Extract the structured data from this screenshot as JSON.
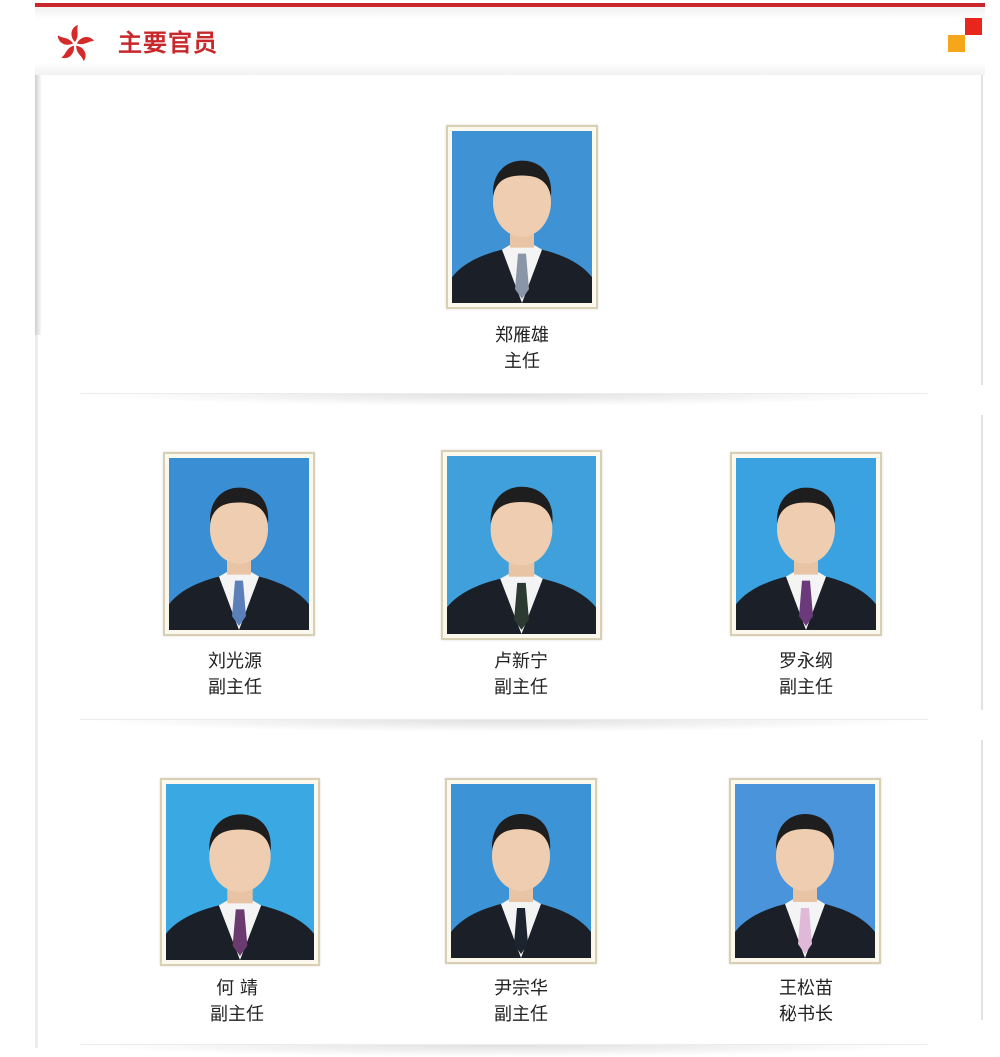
{
  "header": {
    "title": "主要官员",
    "logo_icon": "bauhinia-flower-icon",
    "corner_icon": "corner-squares-icon",
    "accent_color": "#c8282b"
  },
  "officials": [
    {
      "name": "郑雁雄",
      "title": "主任",
      "tie_color": "#8a96a8",
      "bg": "#3f92d4"
    },
    {
      "name": "刘光源",
      "title": "副主任",
      "tie_color": "#5b7fb8",
      "bg": "#3a8fd4"
    },
    {
      "name": "卢新宁",
      "title": "副主任",
      "tie_color": "#2c3a32",
      "bg": "#3fa0dc"
    },
    {
      "name": "罗永纲",
      "title": "副主任",
      "tie_color": "#6b3a7a",
      "bg": "#3aa2e0"
    },
    {
      "name": "何 靖",
      "title": "副主任",
      "tie_color": "#6b3a6e",
      "bg": "#3aa8e2"
    },
    {
      "name": "尹宗华",
      "title": "副主任",
      "tie_color": "#1c2430",
      "bg": "#3c94d6"
    },
    {
      "name": "王松苗",
      "title": "秘书长",
      "tie_color": "#e0b8d8",
      "bg": "#4a94dc"
    }
  ]
}
